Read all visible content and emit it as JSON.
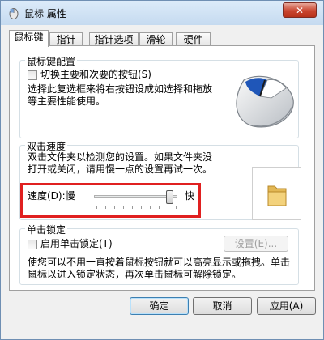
{
  "window": {
    "title": "鼠标 属性",
    "close_label": "✕"
  },
  "tabs": [
    {
      "label": "鼠标键"
    },
    {
      "label": "指针"
    },
    {
      "label": "指针选项"
    },
    {
      "label": "滑轮"
    },
    {
      "label": "硬件"
    }
  ],
  "button_config": {
    "group_label": "鼠标键配置",
    "switch_checkbox_label": "切换主要和次要的按钮(S)",
    "description_line1": "选择此复选框来将右按钮设成如选择和拖放",
    "description_line2": "等主要性能使用。"
  },
  "double_click": {
    "group_label": "双击速度",
    "description_line1": "双击文件夹以检测您的设置。如果文件夹没",
    "description_line2": "打开或关闭，请用慢一点的设置再试一次。",
    "speed_label": "速度(D):慢",
    "fast_label": "快",
    "speed_level": 0.95
  },
  "click_lock": {
    "group_label": "单击锁定",
    "enable_checkbox_label": "启用单击锁定(T)",
    "settings_button": "设置(E)...",
    "description_line1": "使您可以不用一直按着鼠标按钮就可以高亮显示或拖拽。单击",
    "description_line2": "鼠标以进入锁定状态，再次单击鼠标可解除锁定。"
  },
  "footer": {
    "ok": "确定",
    "cancel": "取消",
    "apply": "应用(A)"
  },
  "colors": {
    "highlight": "#e02020",
    "title_bar": "#c5daf0"
  }
}
